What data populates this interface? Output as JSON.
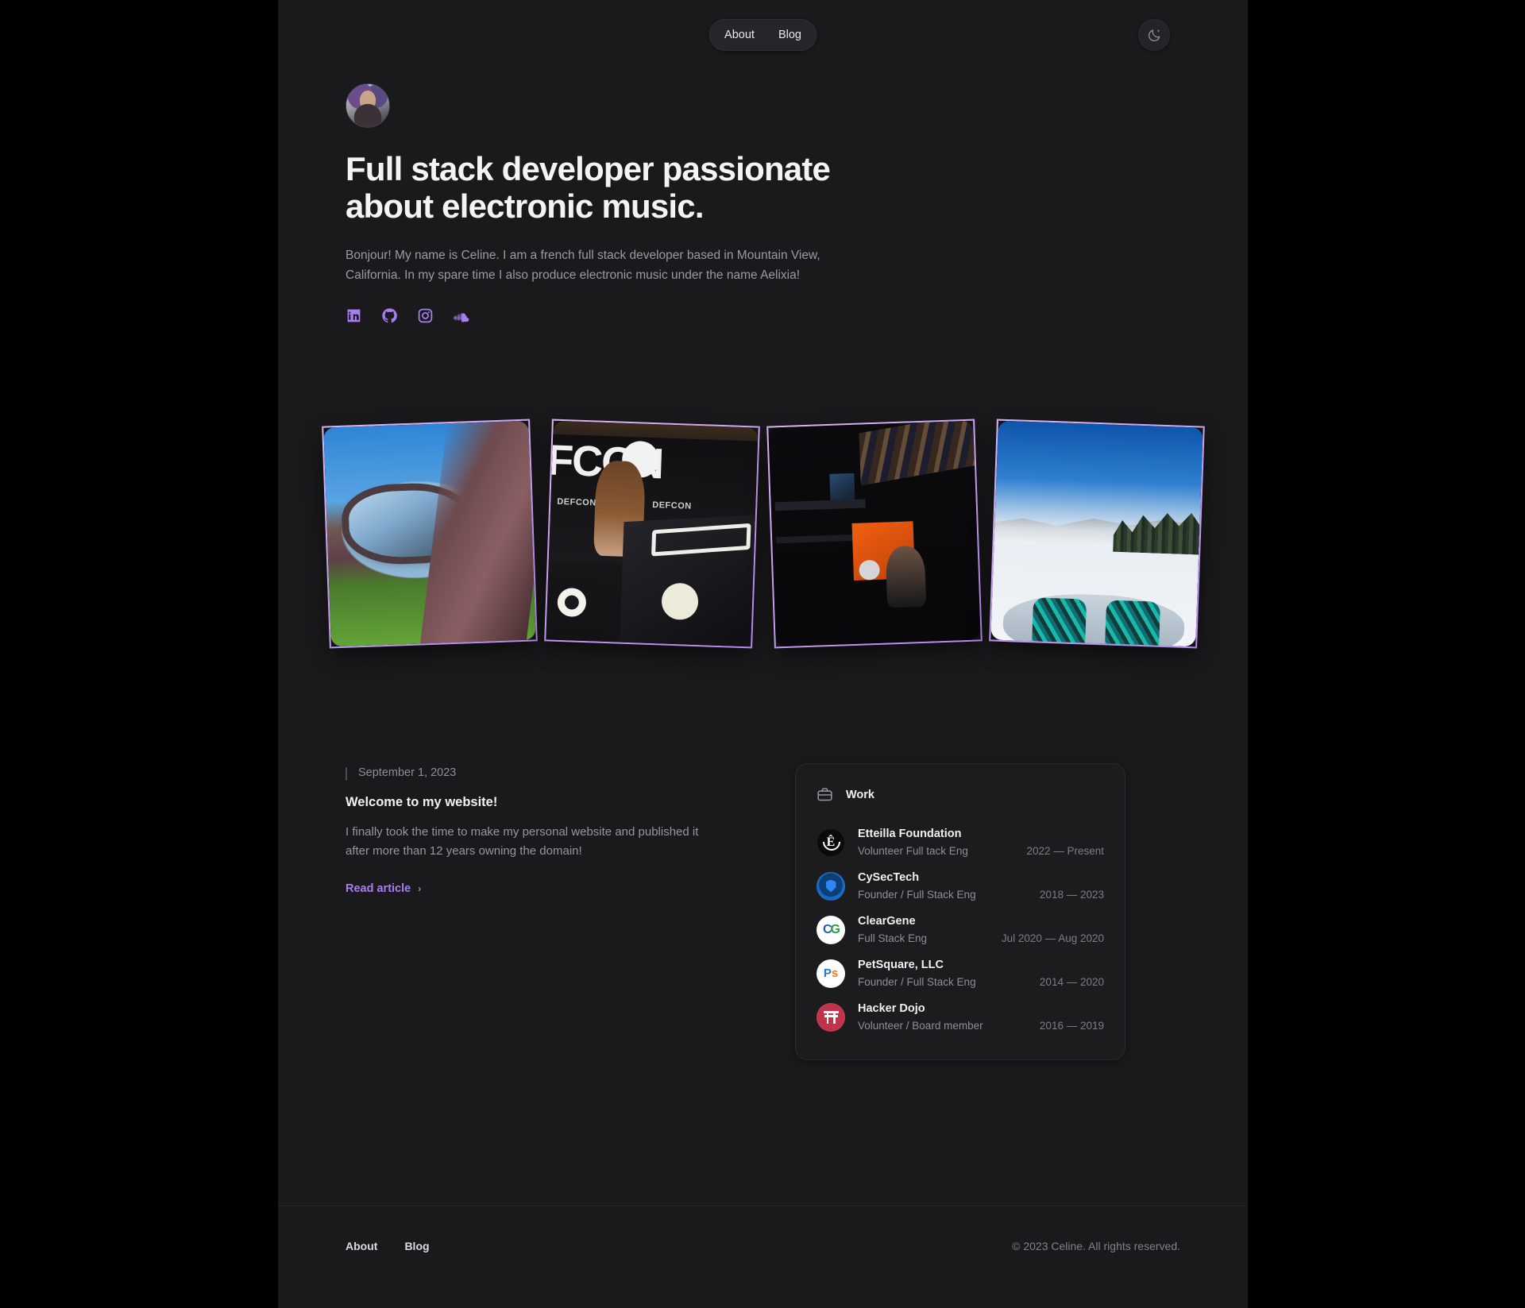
{
  "header": {
    "nav": [
      {
        "label": "About"
      },
      {
        "label": "Blog"
      }
    ],
    "theme_toggle_icon": "moon-icon"
  },
  "intro": {
    "avatar_alt": "Celine portrait with headphones",
    "headline": "Full stack developer passionate about electronic music.",
    "bio": "Bonjour! My name is Celine. I am a french full stack developer based in Mountain View, California. In my spare time I also produce electronic music under the name Aelixia!",
    "accent_color": "#a77ef0",
    "socials": [
      {
        "name": "linkedin-icon",
        "label": "LinkedIn"
      },
      {
        "name": "github-icon",
        "label": "GitHub"
      },
      {
        "name": "instagram-icon",
        "label": "Instagram"
      },
      {
        "name": "soundcloud-icon",
        "label": "SoundCloud"
      }
    ]
  },
  "gallery": {
    "border_color": "#c7a3f2",
    "photos": [
      {
        "alt": "Car side mirror reflection at a car show on grass under blue sky"
      },
      {
        "alt": "Speaking on stage at DEFCON behind a black podium"
      },
      {
        "alt": "Dark club interior with orange DJ booth panel"
      },
      {
        "alt": "Snowboarding first-person view on a snowy mountain slope"
      }
    ]
  },
  "article": {
    "date": "September 1, 2023",
    "title": "Welcome to my website!",
    "excerpt": "I finally took the time to make my personal website and published it after more than 12 years owning the domain!",
    "read_link": "Read article",
    "read_chevron": "›"
  },
  "work": {
    "icon": "briefcase-icon",
    "title": "Work",
    "entries": [
      {
        "company": "Etteilla Foundation",
        "role": "Volunteer Full tack Eng",
        "period": "2022 — Present",
        "logo": "etteilla-logo"
      },
      {
        "company": "CySecTech",
        "role": "Founder / Full Stack Eng",
        "period": "2018 — 2023",
        "logo": "cysectech-logo"
      },
      {
        "company": "ClearGene",
        "role": "Full Stack Eng",
        "period": "Jul 2020 — Aug 2020",
        "logo": "cleargene-logo"
      },
      {
        "company": "PetSquare, LLC",
        "role": "Founder / Full Stack Eng",
        "period": "2014 — 2020",
        "logo": "petsquare-logo"
      },
      {
        "company": "Hacker Dojo",
        "role": "Volunteer / Board member",
        "period": "2016 — 2019",
        "logo": "hackerdojo-logo"
      }
    ]
  },
  "footer": {
    "links": [
      {
        "label": "About"
      },
      {
        "label": "Blog"
      }
    ],
    "copyright": "© 2023 Celine. All rights reserved."
  }
}
